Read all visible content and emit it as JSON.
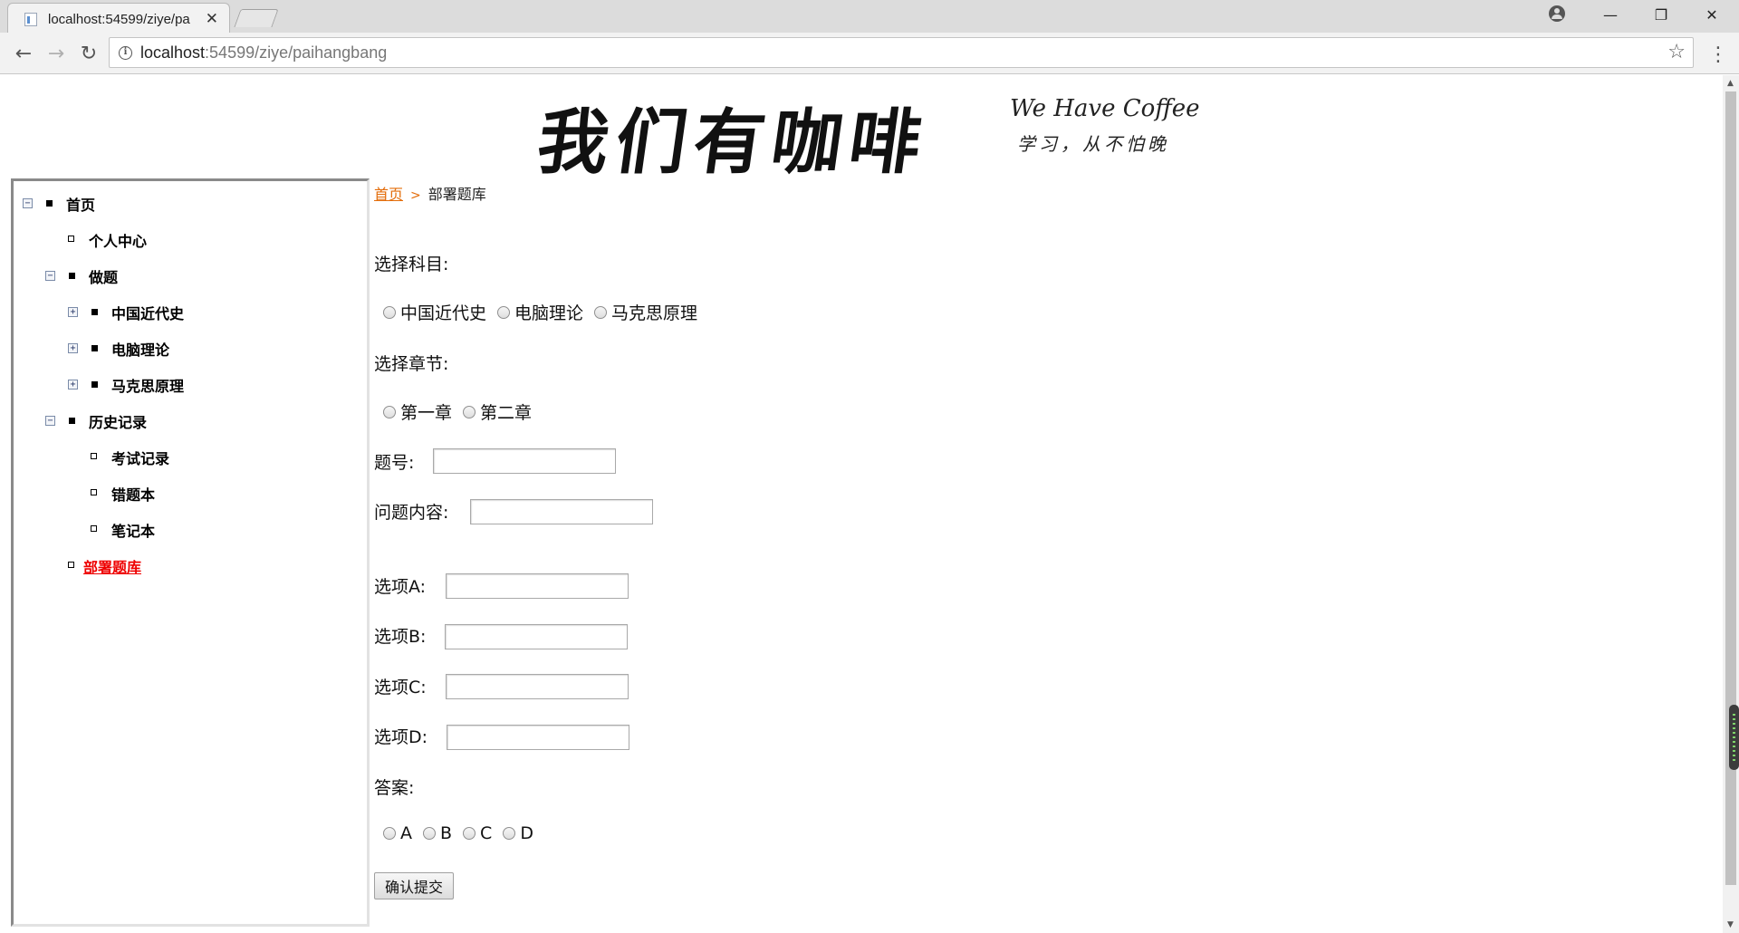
{
  "browser": {
    "tab_title": "localhost:54599/ziye/pa",
    "url_host": "localhost",
    "url_path": ":54599/ziye/paihangbang"
  },
  "logo": {
    "main": "我们有咖啡",
    "english": "We Have Coffee",
    "tagline": "学习，从不怕晚"
  },
  "sidebar": {
    "items": [
      {
        "label": "首页"
      },
      {
        "label": "个人中心"
      },
      {
        "label": "做题"
      },
      {
        "label": "中国近代史"
      },
      {
        "label": "电脑理论"
      },
      {
        "label": "马克思原理"
      },
      {
        "label": "历史记录"
      },
      {
        "label": "考试记录"
      },
      {
        "label": "错题本"
      },
      {
        "label": "笔记本"
      },
      {
        "label": "部署题库"
      }
    ]
  },
  "breadcrumb": {
    "home": "首页",
    "current": "部署题库"
  },
  "form": {
    "subject_label": "选择科目:",
    "subjects": [
      "中国近代史",
      "电脑理论",
      "马克思原理"
    ],
    "chapter_label": "选择章节:",
    "chapters": [
      "第一章",
      "第二章"
    ],
    "number_label": "题号:",
    "content_label": "问题内容:",
    "option_a_label": "选项A:",
    "option_b_label": "选项B:",
    "option_c_label": "选项C:",
    "option_d_label": "选项D:",
    "answer_label": "答案:",
    "answers": [
      "A",
      "B",
      "C",
      "D"
    ],
    "submit_label": "确认提交"
  }
}
